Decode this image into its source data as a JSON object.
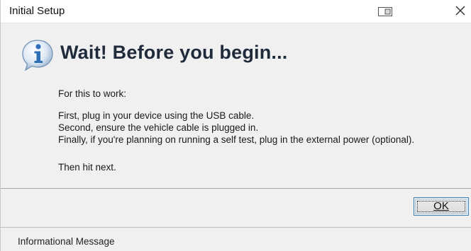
{
  "window": {
    "title": "Initial Setup"
  },
  "dialog": {
    "icon": "info-icon",
    "headline": "Wait! Before you begin...",
    "intro": "For this to work:",
    "steps": [
      "First, plug in your device using the USB cable.",
      "Second, ensure the vehicle cable is plugged in.",
      "Finally, if you're planning on running a self test, plug in the external power (optional)."
    ],
    "outro": "Then hit next."
  },
  "buttons": {
    "ok_label": "OK"
  },
  "status": {
    "text": "Informational Message"
  },
  "colors": {
    "accent": "#3c7fb1",
    "icon_blue": "#2f6fb8",
    "headline": "#1f2a3a"
  }
}
